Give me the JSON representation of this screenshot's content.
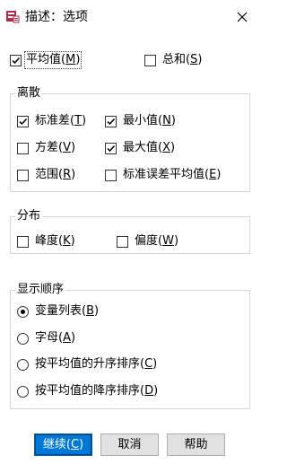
{
  "window": {
    "title": "描述：选项",
    "icon": "spss-dialog-icon",
    "close_icon": "close-icon"
  },
  "top_options": [
    {
      "label": "平均值",
      "mnemonic": "M",
      "checked": true,
      "focused": true
    },
    {
      "label": "总和",
      "mnemonic": "S",
      "checked": false
    }
  ],
  "dispersion": {
    "legend": "离散",
    "items": [
      {
        "label": "标准差",
        "mnemonic": "T",
        "checked": true
      },
      {
        "label": "最小值",
        "mnemonic": "N",
        "checked": true
      },
      {
        "label": "方差",
        "mnemonic": "V",
        "checked": false
      },
      {
        "label": "最大值",
        "mnemonic": "X",
        "checked": true
      },
      {
        "label": "范围",
        "mnemonic": "R",
        "checked": false
      },
      {
        "label": "标准误差平均值",
        "mnemonic": "E",
        "checked": false
      }
    ]
  },
  "distribution": {
    "legend": "分布",
    "items": [
      {
        "label": "峰度",
        "mnemonic": "K",
        "checked": false
      },
      {
        "label": "偏度",
        "mnemonic": "W",
        "checked": false
      }
    ]
  },
  "display_order": {
    "legend": "显示顺序",
    "options": [
      {
        "label": "变量列表",
        "mnemonic": "B",
        "selected": true
      },
      {
        "label": "字母",
        "mnemonic": "A",
        "selected": false
      },
      {
        "label": "按平均值的升序排序",
        "mnemonic": "C",
        "selected": false
      },
      {
        "label": "按平均值的降序排序",
        "mnemonic": "D",
        "selected": false
      }
    ]
  },
  "buttons": {
    "continue": {
      "label": "继续",
      "mnemonic": "C"
    },
    "cancel": {
      "label": "取消"
    },
    "help": {
      "label": "帮助"
    }
  },
  "colors": {
    "default_button": "#0078d7",
    "group_border": "#d6d6d6",
    "button_face": "#e1e1e1"
  }
}
